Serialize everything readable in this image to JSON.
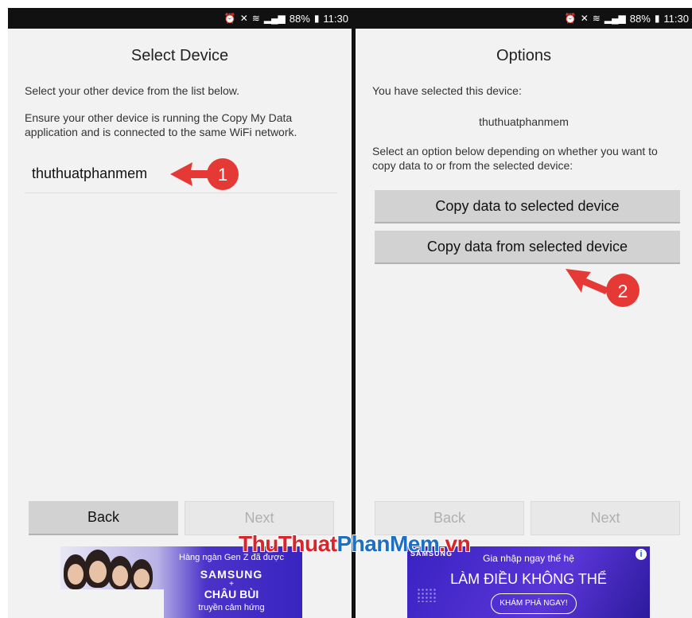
{
  "status_bar": {
    "battery": "88%",
    "time": "11:30"
  },
  "left_screen": {
    "title": "Select Device",
    "instruction": "Select your other device from the list below.",
    "instruction2": "Ensure your other device is running the Copy My Data application and is connected to the same WiFi network.",
    "device_item": "thuthuatphanmem",
    "back_label": "Back",
    "next_label": "Next"
  },
  "right_screen": {
    "title": "Options",
    "selected_label": "You have selected this device:",
    "selected_device": "thuthuatphanmem",
    "instruction": "Select an option below depending on whether you want to copy data to or from the selected device:",
    "copy_to_label": "Copy data to selected device",
    "copy_from_label": "Copy data from selected device",
    "back_label": "Back",
    "next_label": "Next"
  },
  "annotations": {
    "step1": "1",
    "step2": "2",
    "color": "#e53935"
  },
  "ad_left": {
    "line1": "Hàng ngàn Gen Z đã được",
    "line2": "SAMSUNG",
    "line3": "+",
    "line4": "CHÂU BÙI",
    "line5": "truyền cảm hứng"
  },
  "ad_right": {
    "brand": "SAMSUNG",
    "line1": "Gia nhập ngay thế hệ",
    "line2": "LÀM ĐIỀU KHÔNG THỂ",
    "cta": "KHÁM PHÁ NGAY!",
    "info": "i"
  },
  "watermark": {
    "part1": "ThuThuat",
    "part2": "PhanMem",
    "part3": ".vn"
  }
}
